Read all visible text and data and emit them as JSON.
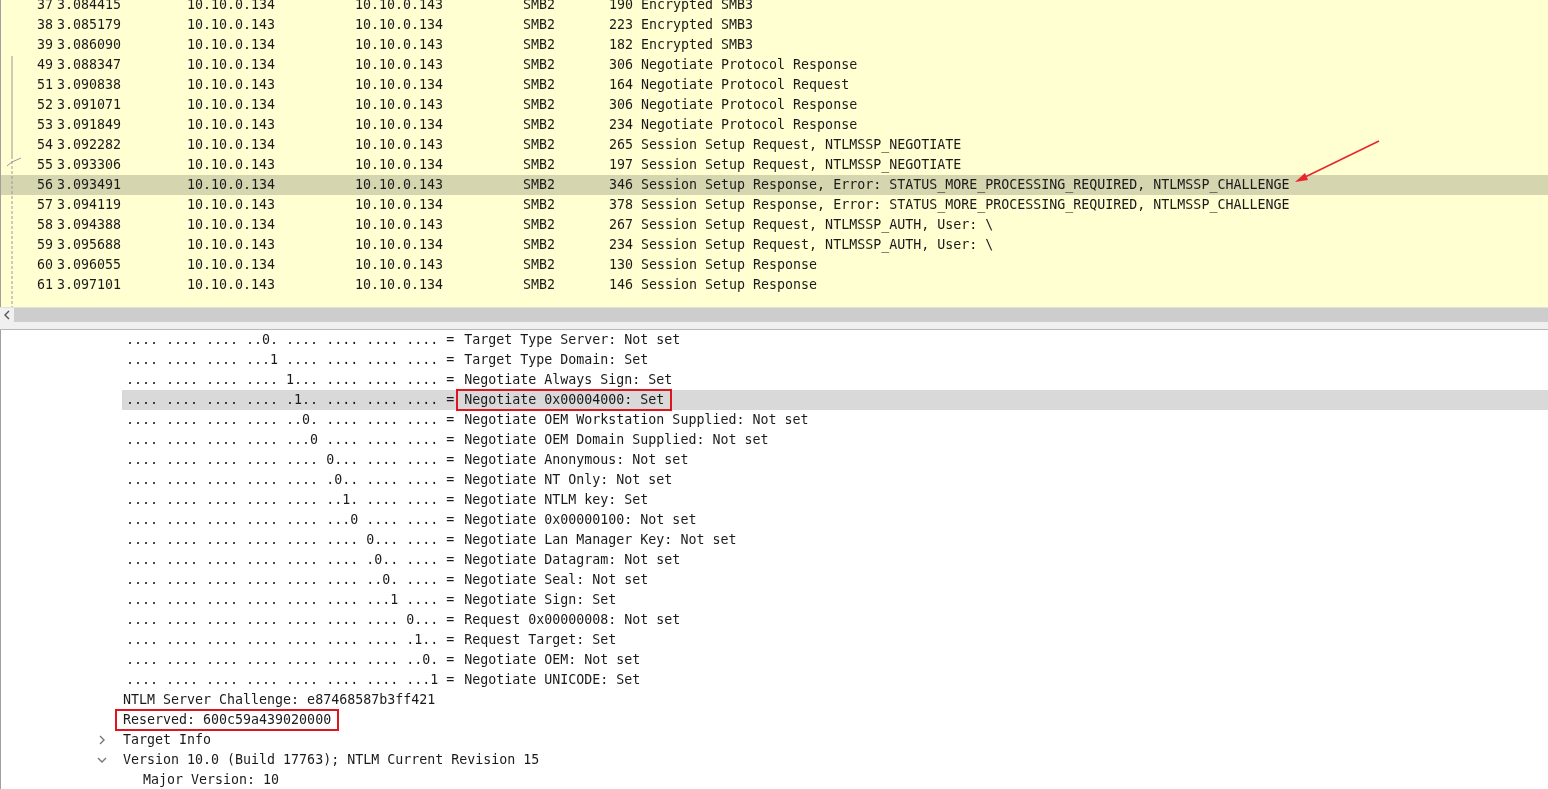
{
  "packet_list": {
    "rows": [
      {
        "no": "37",
        "time": "3.084415",
        "source": "10.10.0.134",
        "destination": "10.10.0.143",
        "protocol": "SMB2",
        "length": "190",
        "info": "Encrypted SMB3",
        "selected": false
      },
      {
        "no": "38",
        "time": "3.085179",
        "source": "10.10.0.143",
        "destination": "10.10.0.134",
        "protocol": "SMB2",
        "length": "223",
        "info": "Encrypted SMB3",
        "selected": false
      },
      {
        "no": "39",
        "time": "3.086090",
        "source": "10.10.0.134",
        "destination": "10.10.0.143",
        "protocol": "SMB2",
        "length": "182",
        "info": "Encrypted SMB3",
        "selected": false
      },
      {
        "no": "49",
        "time": "3.088347",
        "source": "10.10.0.134",
        "destination": "10.10.0.143",
        "protocol": "SMB2",
        "length": "306",
        "info": "Negotiate Protocol Response",
        "selected": false
      },
      {
        "no": "51",
        "time": "3.090838",
        "source": "10.10.0.143",
        "destination": "10.10.0.134",
        "protocol": "SMB2",
        "length": "164",
        "info": "Negotiate Protocol Request",
        "selected": false
      },
      {
        "no": "52",
        "time": "3.091071",
        "source": "10.10.0.134",
        "destination": "10.10.0.143",
        "protocol": "SMB2",
        "length": "306",
        "info": "Negotiate Protocol Response",
        "selected": false
      },
      {
        "no": "53",
        "time": "3.091849",
        "source": "10.10.0.143",
        "destination": "10.10.0.134",
        "protocol": "SMB2",
        "length": "234",
        "info": "Negotiate Protocol Response",
        "selected": false
      },
      {
        "no": "54",
        "time": "3.092282",
        "source": "10.10.0.134",
        "destination": "10.10.0.143",
        "protocol": "SMB2",
        "length": "265",
        "info": "Session Setup Request, NTLMSSP_NEGOTIATE",
        "selected": false
      },
      {
        "no": "55",
        "time": "3.093306",
        "source": "10.10.0.143",
        "destination": "10.10.0.134",
        "protocol": "SMB2",
        "length": "197",
        "info": "Session Setup Request, NTLMSSP_NEGOTIATE",
        "selected": false
      },
      {
        "no": "56",
        "time": "3.093491",
        "source": "10.10.0.134",
        "destination": "10.10.0.143",
        "protocol": "SMB2",
        "length": "346",
        "info": "Session Setup Response, Error: STATUS_MORE_PROCESSING_REQUIRED, NTLMSSP_CHALLENGE",
        "selected": true
      },
      {
        "no": "57",
        "time": "3.094119",
        "source": "10.10.0.143",
        "destination": "10.10.0.134",
        "protocol": "SMB2",
        "length": "378",
        "info": "Session Setup Response, Error: STATUS_MORE_PROCESSING_REQUIRED, NTLMSSP_CHALLENGE",
        "selected": false
      },
      {
        "no": "58",
        "time": "3.094388",
        "source": "10.10.0.134",
        "destination": "10.10.0.143",
        "protocol": "SMB2",
        "length": "267",
        "info": "Session Setup Request, NTLMSSP_AUTH, User: \\",
        "selected": false
      },
      {
        "no": "59",
        "time": "3.095688",
        "source": "10.10.0.143",
        "destination": "10.10.0.134",
        "protocol": "SMB2",
        "length": "234",
        "info": "Session Setup Request, NTLMSSP_AUTH, User: \\",
        "selected": false
      },
      {
        "no": "60",
        "time": "3.096055",
        "source": "10.10.0.134",
        "destination": "10.10.0.143",
        "protocol": "SMB2",
        "length": "130",
        "info": "Session Setup Response",
        "selected": false
      },
      {
        "no": "61",
        "time": "3.097101",
        "source": "10.10.0.143",
        "destination": "10.10.0.134",
        "protocol": "SMB2",
        "length": "146",
        "info": "Session Setup Response",
        "selected": false
      }
    ]
  },
  "details": [
    {
      "kind": "bits",
      "bits": ".... .... .... ..0. .... .... .... .... =",
      "text": "Target Type Server: Not set",
      "selected": false,
      "boxed": false
    },
    {
      "kind": "bits",
      "bits": ".... .... .... ...1 .... .... .... .... =",
      "text": "Target Type Domain: Set",
      "selected": false,
      "boxed": false
    },
    {
      "kind": "bits",
      "bits": ".... .... .... .... 1... .... .... .... =",
      "text": "Negotiate Always Sign: Set",
      "selected": false,
      "boxed": false
    },
    {
      "kind": "bits",
      "bits": ".... .... .... .... .1.. .... .... .... =",
      "text": "Negotiate 0x00004000: Set",
      "selected": true,
      "boxed": true
    },
    {
      "kind": "bits",
      "bits": ".... .... .... .... ..0. .... .... .... =",
      "text": "Negotiate OEM Workstation Supplied: Not set",
      "selected": false,
      "boxed": false
    },
    {
      "kind": "bits",
      "bits": ".... .... .... .... ...0 .... .... .... =",
      "text": "Negotiate OEM Domain Supplied: Not set",
      "selected": false,
      "boxed": false
    },
    {
      "kind": "bits",
      "bits": ".... .... .... .... .... 0... .... .... =",
      "text": "Negotiate Anonymous: Not set",
      "selected": false,
      "boxed": false
    },
    {
      "kind": "bits",
      "bits": ".... .... .... .... .... .0.. .... .... =",
      "text": "Negotiate NT Only: Not set",
      "selected": false,
      "boxed": false
    },
    {
      "kind": "bits",
      "bits": ".... .... .... .... .... ..1. .... .... =",
      "text": "Negotiate NTLM key: Set",
      "selected": false,
      "boxed": false
    },
    {
      "kind": "bits",
      "bits": ".... .... .... .... .... ...0 .... .... =",
      "text": "Negotiate 0x00000100: Not set",
      "selected": false,
      "boxed": false
    },
    {
      "kind": "bits",
      "bits": ".... .... .... .... .... .... 0... .... =",
      "text": "Negotiate Lan Manager Key: Not set",
      "selected": false,
      "boxed": false
    },
    {
      "kind": "bits",
      "bits": ".... .... .... .... .... .... .0.. .... =",
      "text": "Negotiate Datagram: Not set",
      "selected": false,
      "boxed": false
    },
    {
      "kind": "bits",
      "bits": ".... .... .... .... .... .... ..0. .... =",
      "text": "Negotiate Seal: Not set",
      "selected": false,
      "boxed": false
    },
    {
      "kind": "bits",
      "bits": ".... .... .... .... .... .... ...1 .... =",
      "text": "Negotiate Sign: Set",
      "selected": false,
      "boxed": false
    },
    {
      "kind": "bits",
      "bits": ".... .... .... .... .... .... .... 0... =",
      "text": "Request 0x00000008: Not set",
      "selected": false,
      "boxed": false
    },
    {
      "kind": "bits",
      "bits": ".... .... .... .... .... .... .... .1.. =",
      "text": "Request Target: Set",
      "selected": false,
      "boxed": false
    },
    {
      "kind": "bits",
      "bits": ".... .... .... .... .... .... .... ..0. =",
      "text": "Negotiate OEM: Not set",
      "selected": false,
      "boxed": false
    },
    {
      "kind": "bits",
      "bits": ".... .... .... .... .... .... .... ...1 =",
      "text": "Negotiate UNICODE: Set",
      "selected": false,
      "boxed": false
    },
    {
      "kind": "field",
      "text": "NTLM Server Challenge: e87468587b3ff421",
      "selected": false,
      "boxed": false
    },
    {
      "kind": "field",
      "text": "Reserved: 600c59a439020000",
      "selected": false,
      "boxed": true
    },
    {
      "kind": "field",
      "text": "Target Info",
      "selected": false,
      "boxed": false,
      "expanded": false
    },
    {
      "kind": "field",
      "text": "Version 10.0 (Build 17763); NTLM Current Revision 15",
      "selected": false,
      "boxed": false,
      "expanded": true,
      "children": [
        {
          "kind": "field",
          "text": "Major Version: 10",
          "selected": false,
          "boxed": false
        }
      ]
    }
  ]
}
